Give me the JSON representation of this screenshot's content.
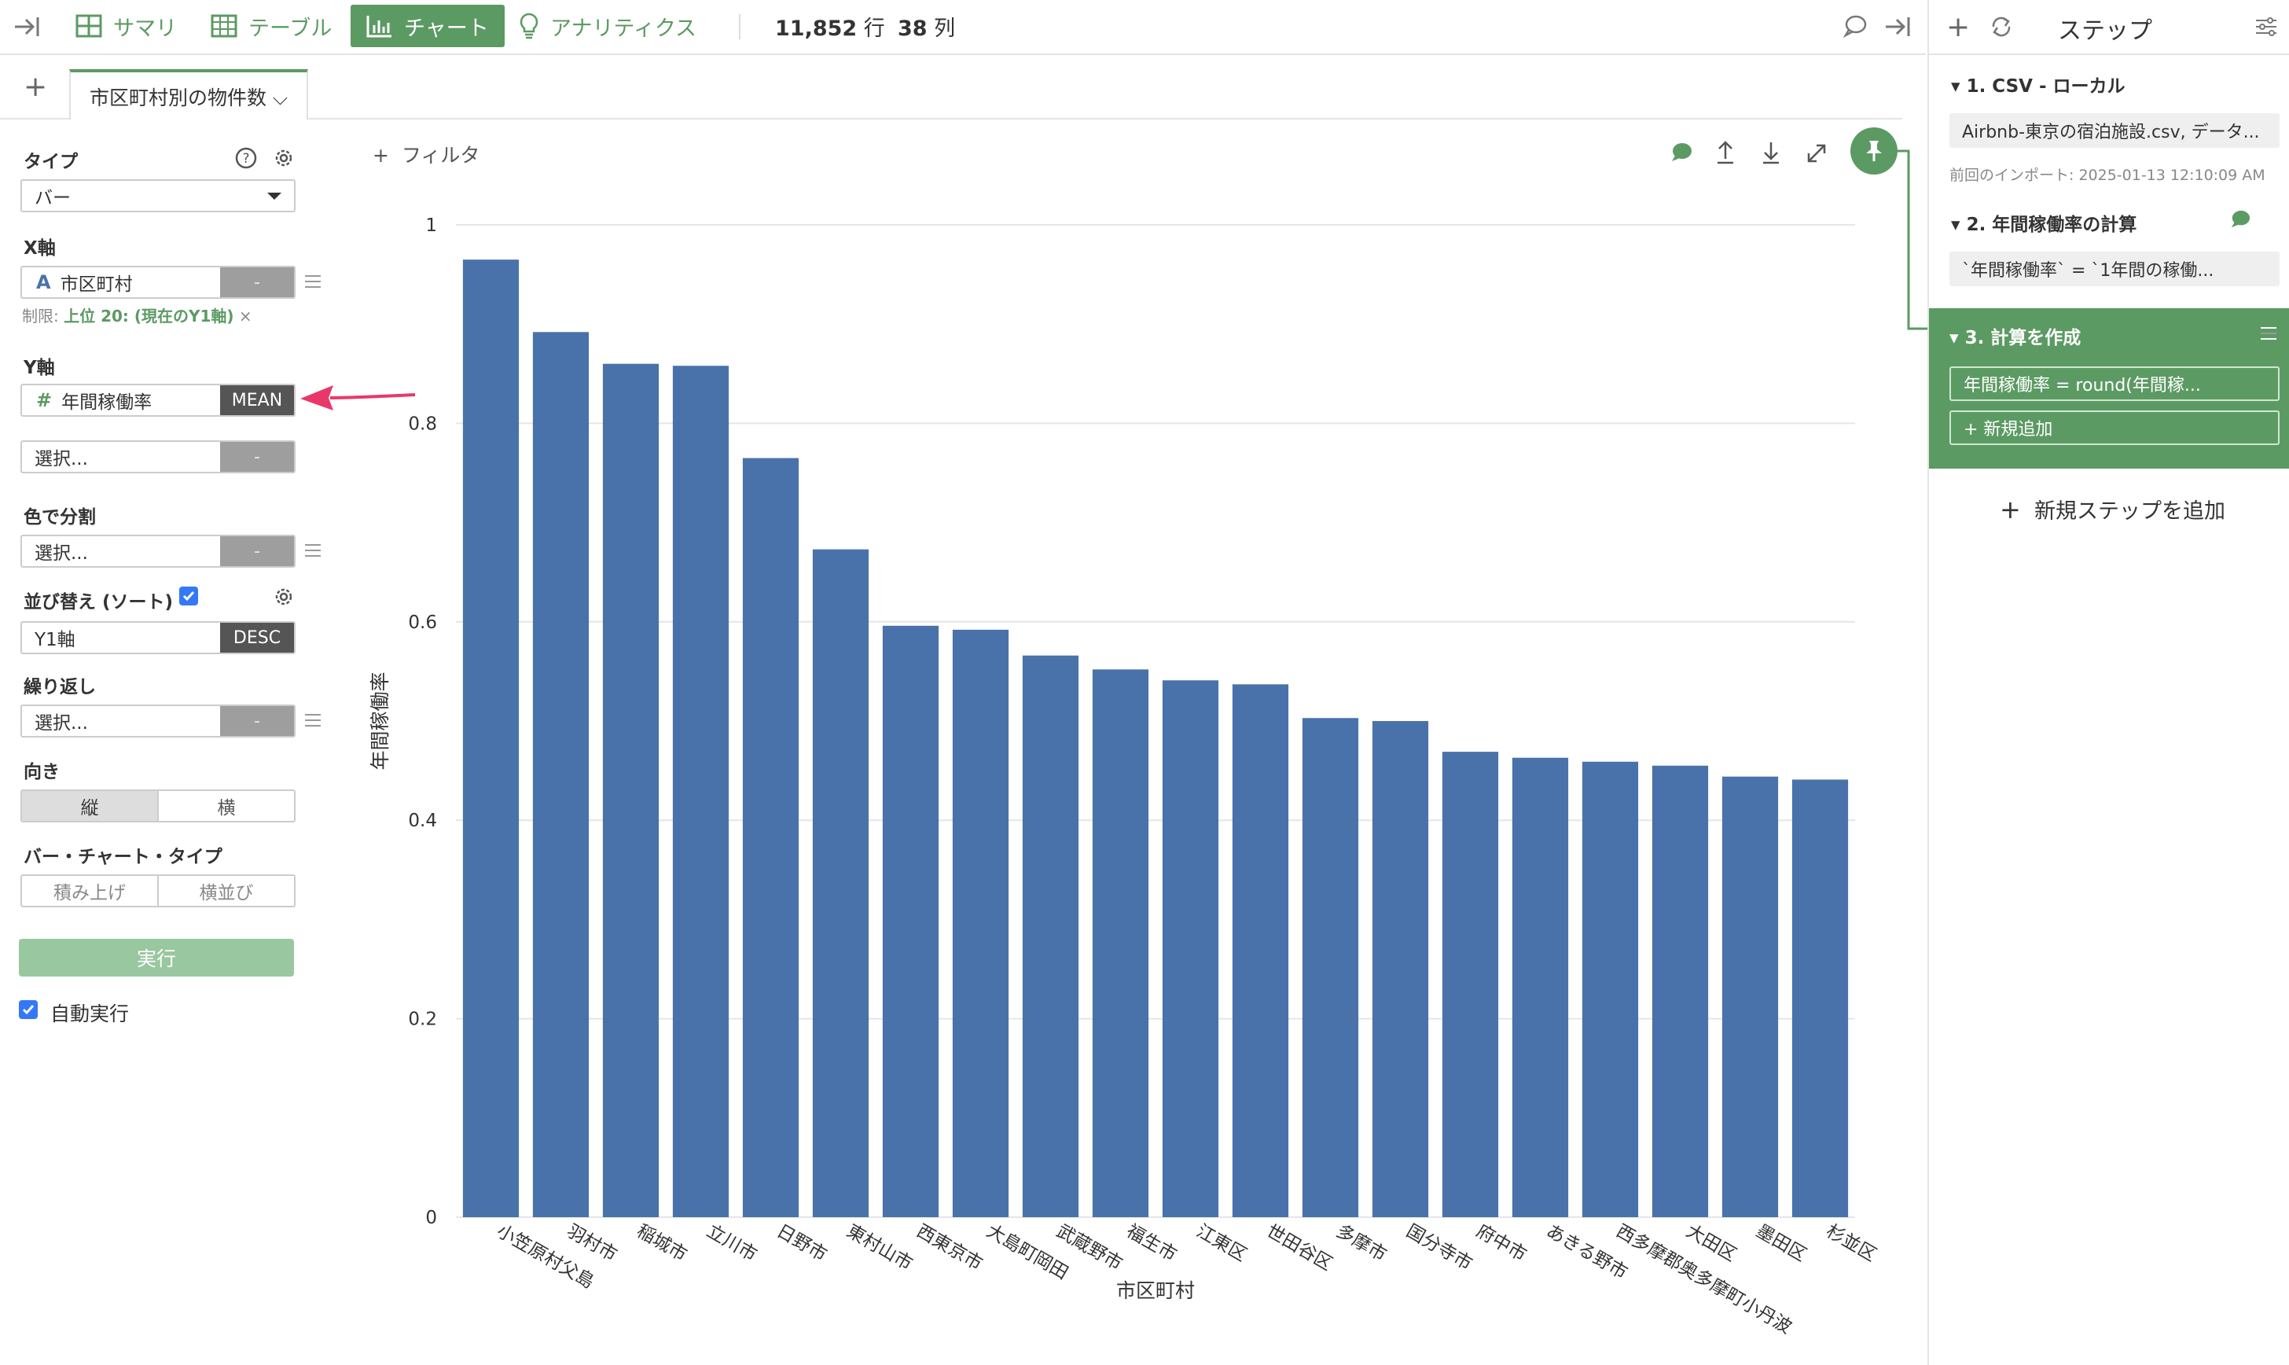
{
  "toolbar": {
    "summary": "サマリ",
    "table": "テーブル",
    "chart": "チャート",
    "analytics": "アナリティクス",
    "rows_value": "11,852",
    "rows_unit": "行",
    "cols_value": "38",
    "cols_unit": "列"
  },
  "tabs": {
    "add": "+",
    "active": "市区町村別の物件数 ⌵"
  },
  "left_panel": {
    "type_label": "タイプ",
    "type_value": "バー",
    "x_label": "X軸",
    "x_field_icon": "A",
    "x_field": "市区町村",
    "x_agg": "-",
    "limit_prefix": "制限:",
    "limit_value": "上位 20: (現在のY1軸)",
    "limit_close": "×",
    "y_label": "Y軸",
    "y_field_icon": "#",
    "y_field": "年間稼働率",
    "y_agg": "MEAN",
    "y2_placeholder": "選択...",
    "y2_agg": "-",
    "color_label": "色で分割",
    "color_placeholder": "選択...",
    "color_agg": "-",
    "sort_label": "並び替え (ソート)",
    "sort_field": "Y1軸",
    "sort_order": "DESC",
    "repeat_label": "繰り返し",
    "repeat_placeholder": "選択...",
    "repeat_agg": "-",
    "orientation_label": "向き",
    "orient_vertical": "縦",
    "orient_horizontal": "横",
    "bar_type_label": "バー・チャート・タイプ",
    "bar_stacked": "積み上げ",
    "bar_side": "横並び",
    "run_button": "実行",
    "auto_run": "自動実行"
  },
  "chart_toolbar": {
    "filter": "フィルタ"
  },
  "chart_data": {
    "type": "bar",
    "categories": [
      "小笠原村父島",
      "羽村市",
      "稲城市",
      "立川市",
      "日野市",
      "東村山市",
      "西東京市",
      "大島町岡田",
      "武蔵野市",
      "福生市",
      "江東区",
      "世田谷区",
      "多摩市",
      "国分寺市",
      "府中市",
      "あきる野市",
      "西多摩郡奥多摩町小丹波",
      "大田区",
      "墨田区",
      "杉並区"
    ],
    "values": [
      0.965,
      0.892,
      0.86,
      0.858,
      0.765,
      0.673,
      0.596,
      0.592,
      0.566,
      0.552,
      0.541,
      0.537,
      0.503,
      0.5,
      0.469,
      0.463,
      0.459,
      0.455,
      0.444,
      0.441
    ],
    "xlabel": "市区町村",
    "ylabel": "年間稼働率",
    "ylim": [
      0,
      1
    ],
    "yticks": [
      "0",
      "0.2",
      "0.4",
      "0.6",
      "0.8",
      "1"
    ],
    "grid": true,
    "bar_color": "#4a72aa"
  },
  "steps_panel": {
    "title": "ステップ",
    "step1_title": "1. CSV - ローカル",
    "step1_detail": "Airbnb-東京の宿泊施設.csv, データ...",
    "step1_meta": "前回のインポート: 2025-01-13 12:10:09 AM",
    "step2_title": "2. 年間稼働率の計算",
    "step2_detail": "`年間稼働率` = `1年間の稼働...",
    "step3_title": "3. 計算を作成",
    "step3_detail": "年間稼働率 = round(年間稼...",
    "step3_add": "+ 新規追加",
    "add_step": "新規ステップを追加"
  },
  "colors": {
    "accent": "#5c9a63",
    "bar": "#4a72aa",
    "annotation_arrow": "#e8386a"
  }
}
